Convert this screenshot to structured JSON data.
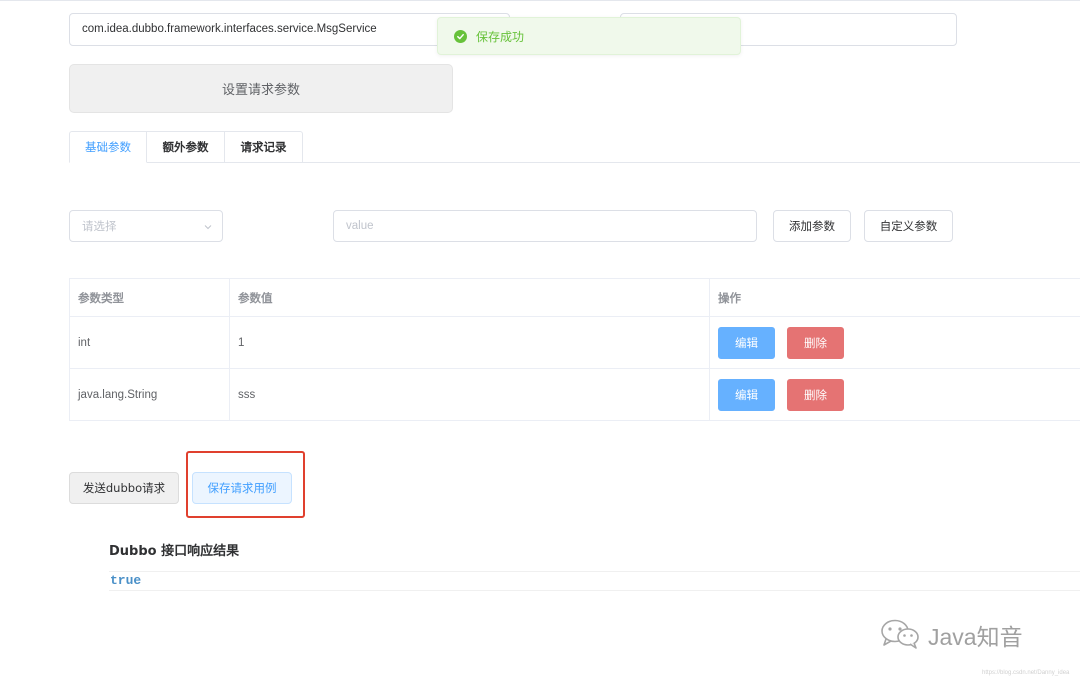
{
  "form": {
    "interface_value": "com.idea.dubbo.framework.interfaces.service.MsgService",
    "method_value": "",
    "set_params_label": "设置请求参数"
  },
  "toast": {
    "message": "保存成功",
    "color": "#67c23a"
  },
  "tabs": [
    {
      "label": "基础参数",
      "active": true
    },
    {
      "label": "额外参数",
      "active": false
    },
    {
      "label": "请求记录",
      "active": false
    }
  ],
  "param_form": {
    "select_placeholder": "请选择",
    "value_placeholder": "value",
    "add_label": "添加参数",
    "custom_label": "自定义参数"
  },
  "table": {
    "headers": [
      "参数类型",
      "参数值",
      "操作"
    ],
    "rows": [
      {
        "type": "int",
        "value": "1",
        "edit_label": "编辑",
        "delete_label": "删除"
      },
      {
        "type": "java.lang.String",
        "value": "sss",
        "edit_label": "编辑",
        "delete_label": "删除"
      }
    ]
  },
  "actions": {
    "send_label": "发送dubbo请求",
    "save_case_label": "保存请求用例"
  },
  "result": {
    "title": "Dubbo 接口响应结果",
    "value": "true"
  },
  "watermark": {
    "text": "Java知音",
    "url": "https://blog.csdn.net/Danny_idea"
  },
  "colors": {
    "primary": "#409eff",
    "success": "#67c23a",
    "danger": "#e57373",
    "highlight": "#e0402e"
  }
}
